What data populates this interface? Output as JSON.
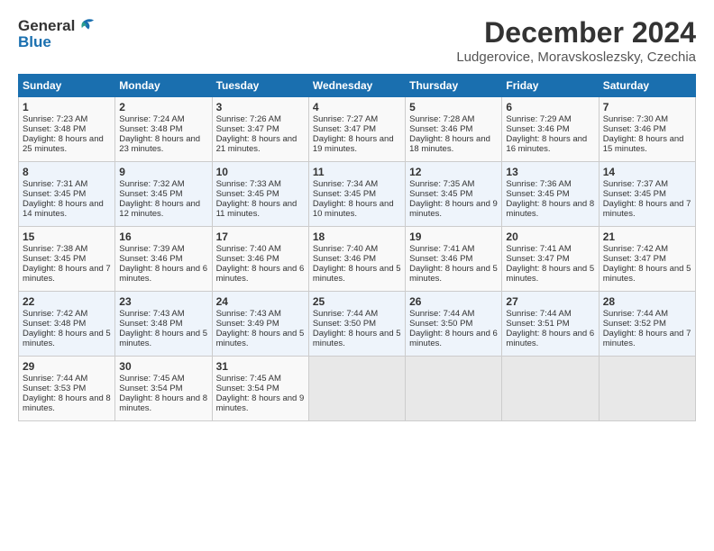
{
  "logo": {
    "line1": "General",
    "line2": "Blue"
  },
  "title": "December 2024",
  "subtitle": "Ludgerovice, Moravskoslezsky, Czechia",
  "header_days": [
    "Sunday",
    "Monday",
    "Tuesday",
    "Wednesday",
    "Thursday",
    "Friday",
    "Saturday"
  ],
  "weeks": [
    [
      {
        "day": "1",
        "sunrise": "Sunrise: 7:23 AM",
        "sunset": "Sunset: 3:48 PM",
        "daylight": "Daylight: 8 hours and 25 minutes."
      },
      {
        "day": "2",
        "sunrise": "Sunrise: 7:24 AM",
        "sunset": "Sunset: 3:48 PM",
        "daylight": "Daylight: 8 hours and 23 minutes."
      },
      {
        "day": "3",
        "sunrise": "Sunrise: 7:26 AM",
        "sunset": "Sunset: 3:47 PM",
        "daylight": "Daylight: 8 hours and 21 minutes."
      },
      {
        "day": "4",
        "sunrise": "Sunrise: 7:27 AM",
        "sunset": "Sunset: 3:47 PM",
        "daylight": "Daylight: 8 hours and 19 minutes."
      },
      {
        "day": "5",
        "sunrise": "Sunrise: 7:28 AM",
        "sunset": "Sunset: 3:46 PM",
        "daylight": "Daylight: 8 hours and 18 minutes."
      },
      {
        "day": "6",
        "sunrise": "Sunrise: 7:29 AM",
        "sunset": "Sunset: 3:46 PM",
        "daylight": "Daylight: 8 hours and 16 minutes."
      },
      {
        "day": "7",
        "sunrise": "Sunrise: 7:30 AM",
        "sunset": "Sunset: 3:46 PM",
        "daylight": "Daylight: 8 hours and 15 minutes."
      }
    ],
    [
      {
        "day": "8",
        "sunrise": "Sunrise: 7:31 AM",
        "sunset": "Sunset: 3:45 PM",
        "daylight": "Daylight: 8 hours and 14 minutes."
      },
      {
        "day": "9",
        "sunrise": "Sunrise: 7:32 AM",
        "sunset": "Sunset: 3:45 PM",
        "daylight": "Daylight: 8 hours and 12 minutes."
      },
      {
        "day": "10",
        "sunrise": "Sunrise: 7:33 AM",
        "sunset": "Sunset: 3:45 PM",
        "daylight": "Daylight: 8 hours and 11 minutes."
      },
      {
        "day": "11",
        "sunrise": "Sunrise: 7:34 AM",
        "sunset": "Sunset: 3:45 PM",
        "daylight": "Daylight: 8 hours and 10 minutes."
      },
      {
        "day": "12",
        "sunrise": "Sunrise: 7:35 AM",
        "sunset": "Sunset: 3:45 PM",
        "daylight": "Daylight: 8 hours and 9 minutes."
      },
      {
        "day": "13",
        "sunrise": "Sunrise: 7:36 AM",
        "sunset": "Sunset: 3:45 PM",
        "daylight": "Daylight: 8 hours and 8 minutes."
      },
      {
        "day": "14",
        "sunrise": "Sunrise: 7:37 AM",
        "sunset": "Sunset: 3:45 PM",
        "daylight": "Daylight: 8 hours and 7 minutes."
      }
    ],
    [
      {
        "day": "15",
        "sunrise": "Sunrise: 7:38 AM",
        "sunset": "Sunset: 3:45 PM",
        "daylight": "Daylight: 8 hours and 7 minutes."
      },
      {
        "day": "16",
        "sunrise": "Sunrise: 7:39 AM",
        "sunset": "Sunset: 3:46 PM",
        "daylight": "Daylight: 8 hours and 6 minutes."
      },
      {
        "day": "17",
        "sunrise": "Sunrise: 7:40 AM",
        "sunset": "Sunset: 3:46 PM",
        "daylight": "Daylight: 8 hours and 6 minutes."
      },
      {
        "day": "18",
        "sunrise": "Sunrise: 7:40 AM",
        "sunset": "Sunset: 3:46 PM",
        "daylight": "Daylight: 8 hours and 5 minutes."
      },
      {
        "day": "19",
        "sunrise": "Sunrise: 7:41 AM",
        "sunset": "Sunset: 3:46 PM",
        "daylight": "Daylight: 8 hours and 5 minutes."
      },
      {
        "day": "20",
        "sunrise": "Sunrise: 7:41 AM",
        "sunset": "Sunset: 3:47 PM",
        "daylight": "Daylight: 8 hours and 5 minutes."
      },
      {
        "day": "21",
        "sunrise": "Sunrise: 7:42 AM",
        "sunset": "Sunset: 3:47 PM",
        "daylight": "Daylight: 8 hours and 5 minutes."
      }
    ],
    [
      {
        "day": "22",
        "sunrise": "Sunrise: 7:42 AM",
        "sunset": "Sunset: 3:48 PM",
        "daylight": "Daylight: 8 hours and 5 minutes."
      },
      {
        "day": "23",
        "sunrise": "Sunrise: 7:43 AM",
        "sunset": "Sunset: 3:48 PM",
        "daylight": "Daylight: 8 hours and 5 minutes."
      },
      {
        "day": "24",
        "sunrise": "Sunrise: 7:43 AM",
        "sunset": "Sunset: 3:49 PM",
        "daylight": "Daylight: 8 hours and 5 minutes."
      },
      {
        "day": "25",
        "sunrise": "Sunrise: 7:44 AM",
        "sunset": "Sunset: 3:50 PM",
        "daylight": "Daylight: 8 hours and 5 minutes."
      },
      {
        "day": "26",
        "sunrise": "Sunrise: 7:44 AM",
        "sunset": "Sunset: 3:50 PM",
        "daylight": "Daylight: 8 hours and 6 minutes."
      },
      {
        "day": "27",
        "sunrise": "Sunrise: 7:44 AM",
        "sunset": "Sunset: 3:51 PM",
        "daylight": "Daylight: 8 hours and 6 minutes."
      },
      {
        "day": "28",
        "sunrise": "Sunrise: 7:44 AM",
        "sunset": "Sunset: 3:52 PM",
        "daylight": "Daylight: 8 hours and 7 minutes."
      }
    ],
    [
      {
        "day": "29",
        "sunrise": "Sunrise: 7:44 AM",
        "sunset": "Sunset: 3:53 PM",
        "daylight": "Daylight: 8 hours and 8 minutes."
      },
      {
        "day": "30",
        "sunrise": "Sunrise: 7:45 AM",
        "sunset": "Sunset: 3:54 PM",
        "daylight": "Daylight: 8 hours and 8 minutes."
      },
      {
        "day": "31",
        "sunrise": "Sunrise: 7:45 AM",
        "sunset": "Sunset: 3:54 PM",
        "daylight": "Daylight: 8 hours and 9 minutes."
      },
      null,
      null,
      null,
      null
    ]
  ]
}
